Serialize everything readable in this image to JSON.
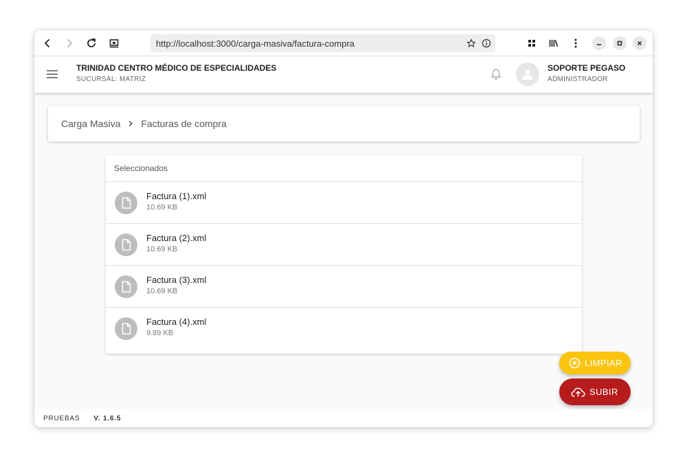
{
  "browser": {
    "url": "http://localhost:3000/carga-masiva/factura-compra",
    "icons": [
      "back-icon",
      "forward-icon",
      "reload-icon",
      "cast-icon",
      "star-icon",
      "info-icon",
      "extensions-icon",
      "library-icon",
      "kebab-menu-icon",
      "minimize-icon",
      "maximize-icon",
      "close-icon"
    ]
  },
  "header": {
    "org_name": "TRINIDAD CENTRO MÉDICO DE ESPECIALIDADES",
    "branch": "SUCURSAL: MATRIZ",
    "user_name": "SOPORTE PEGASO",
    "user_role": "ADMINISTRADOR"
  },
  "breadcrumb": {
    "items": [
      "Carga Masiva",
      "Facturas de compra"
    ]
  },
  "files": {
    "header": "Seleccionados",
    "items": [
      {
        "name": "Factura (1).xml",
        "size": "10.69 KB"
      },
      {
        "name": "Factura (2).xml",
        "size": "10.69 KB"
      },
      {
        "name": "Factura (3).xml",
        "size": "10.69 KB"
      },
      {
        "name": "Factura (4).xml",
        "size": "9.89 KB"
      }
    ]
  },
  "actions": {
    "clear_label": "LIMPIAR",
    "upload_label": "SUBIR"
  },
  "footer": {
    "env": "PRUEBAS",
    "version": "V. 1.6.5"
  },
  "colors": {
    "clear_button": "#fbc40e",
    "upload_button": "#b71c1c",
    "file_avatar": "#bdbdbd"
  }
}
